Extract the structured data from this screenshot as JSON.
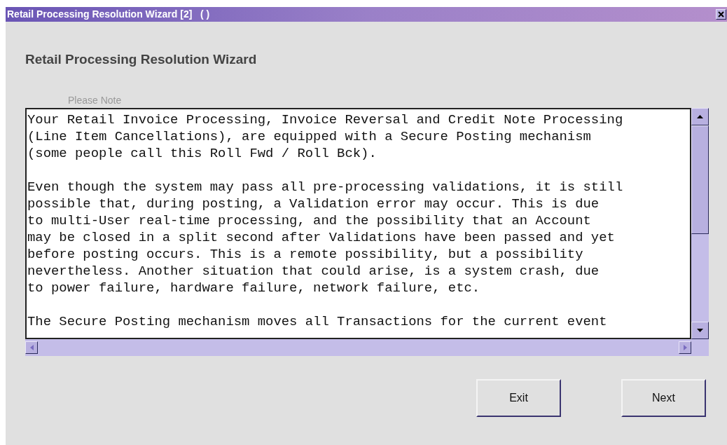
{
  "window": {
    "title": "Retail Processing Resolution Wizard [2]   ( )"
  },
  "heading": "Retail Processing Resolution Wizard",
  "note": {
    "label": "Please Note",
    "paragraphs": [
      [
        "Your Retail Invoice Processing, Invoice Reversal and Credit Note Processing",
        "(Line Item Cancellations), are equipped with a Secure Posting mechanism",
        "(some people call this Roll Fwd / Roll Bck)."
      ],
      [
        "Even though the system may pass all pre-processing validations, it is still",
        "possible that, during posting, a Validation error may occur. This is due",
        "to multi-User real-time processing, and the possibility that an Account",
        "may be closed in a split second after Validations have been passed and yet",
        "before posting occurs. This is a remote possibility, but a possibility",
        "nevertheless. Another situation that could arise, is a system crash, due",
        "to power failure, hardware failure, network failure, etc."
      ],
      [
        "The Secure Posting mechanism moves all Transactions for the current event"
      ]
    ]
  },
  "buttons": [
    "Exit",
    "Next"
  ]
}
